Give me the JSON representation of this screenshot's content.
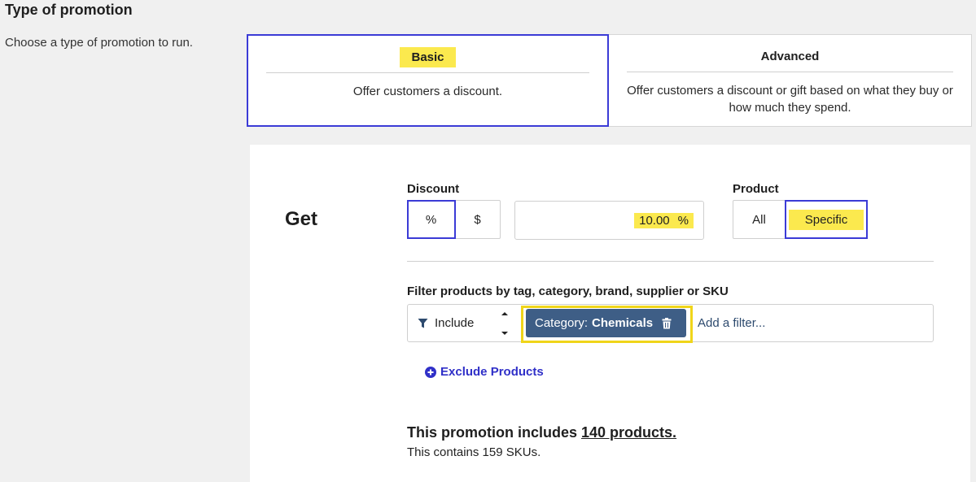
{
  "section": {
    "title": "Type of promotion",
    "description": "Choose a type of promotion to run."
  },
  "types": [
    {
      "title": "Basic",
      "description": "Offer customers a discount.",
      "selected": true
    },
    {
      "title": "Advanced",
      "description": "Offer customers a discount or gift based on what they buy or how much they spend.",
      "selected": false
    }
  ],
  "get": {
    "label": "Get",
    "discount": {
      "label": "Discount",
      "percent_label": "%",
      "dollar_label": "$",
      "selected": "%",
      "value": "10.00",
      "unit": "%"
    },
    "product": {
      "label": "Product",
      "all_label": "All",
      "specific_label": "Specific",
      "selected": "Specific"
    },
    "filter": {
      "label": "Filter products by tag, category, brand, supplier or SKU",
      "mode": "Include",
      "tag_key": "Category:",
      "tag_value": "Chemicals",
      "placeholder": "Add a filter..."
    },
    "exclude_label": "Exclude Products",
    "summary_prefix": "This promotion includes ",
    "summary_link": "140 products.",
    "sku_text": "This contains 159 SKUs."
  },
  "colors": {
    "accent": "#3b3bd6",
    "highlight": "#fbe94e",
    "tag_bg": "#3e5e86",
    "link": "#3030c8"
  }
}
